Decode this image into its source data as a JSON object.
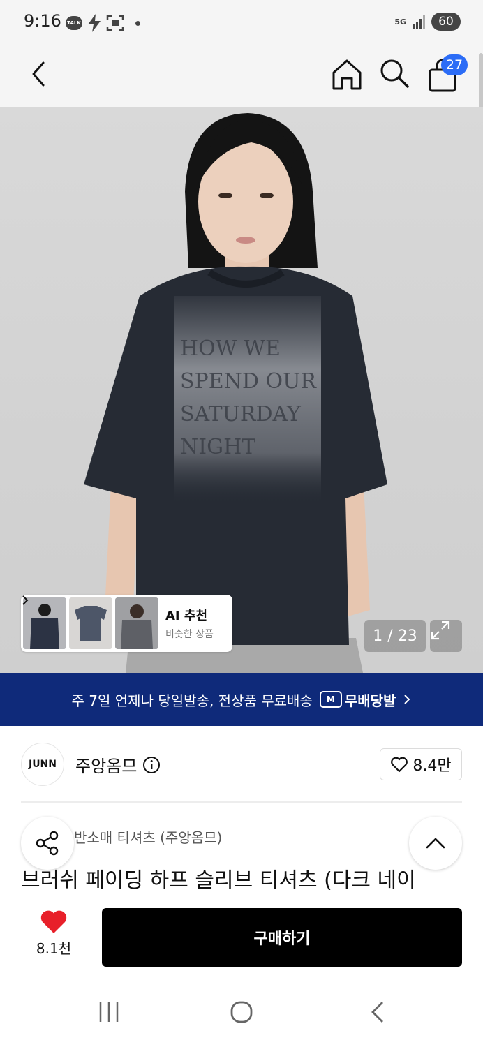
{
  "status_bar": {
    "time": "9:16",
    "talk_label": "TALK",
    "network": "5G",
    "battery": "60"
  },
  "nav": {
    "cart_count": "27"
  },
  "gallery": {
    "shirt_print_lines": [
      "HOW WE",
      "SPEND OUR",
      "SATURDAY",
      "NIGHT"
    ],
    "ai_recommend": {
      "title": "AI 추천",
      "subtitle": "비슷한 상품"
    },
    "page_counter": "1 / 23"
  },
  "delivery_banner": {
    "text": "주 7일 언제나 당일발송, 전상품 무료배송",
    "logo_mark": "M",
    "logo_text": "무배당발"
  },
  "brand": {
    "logo_text": "JUNN",
    "name": "주앙옴므",
    "likes": "8.4만"
  },
  "product": {
    "breadcrumb": "반소매 티셔츠 (주앙옴므)",
    "title": "브러쉬 페이딩 하프 슬리브 티셔츠 (다크 네이"
  },
  "bottom_bar": {
    "wish_count": "8.1천",
    "buy_label": "구매하기"
  },
  "colors": {
    "banner_bg": "#0f2a7a",
    "badge_blue": "#2b6cf6",
    "heart_red": "#e8202a",
    "buy_bg": "#000000"
  }
}
